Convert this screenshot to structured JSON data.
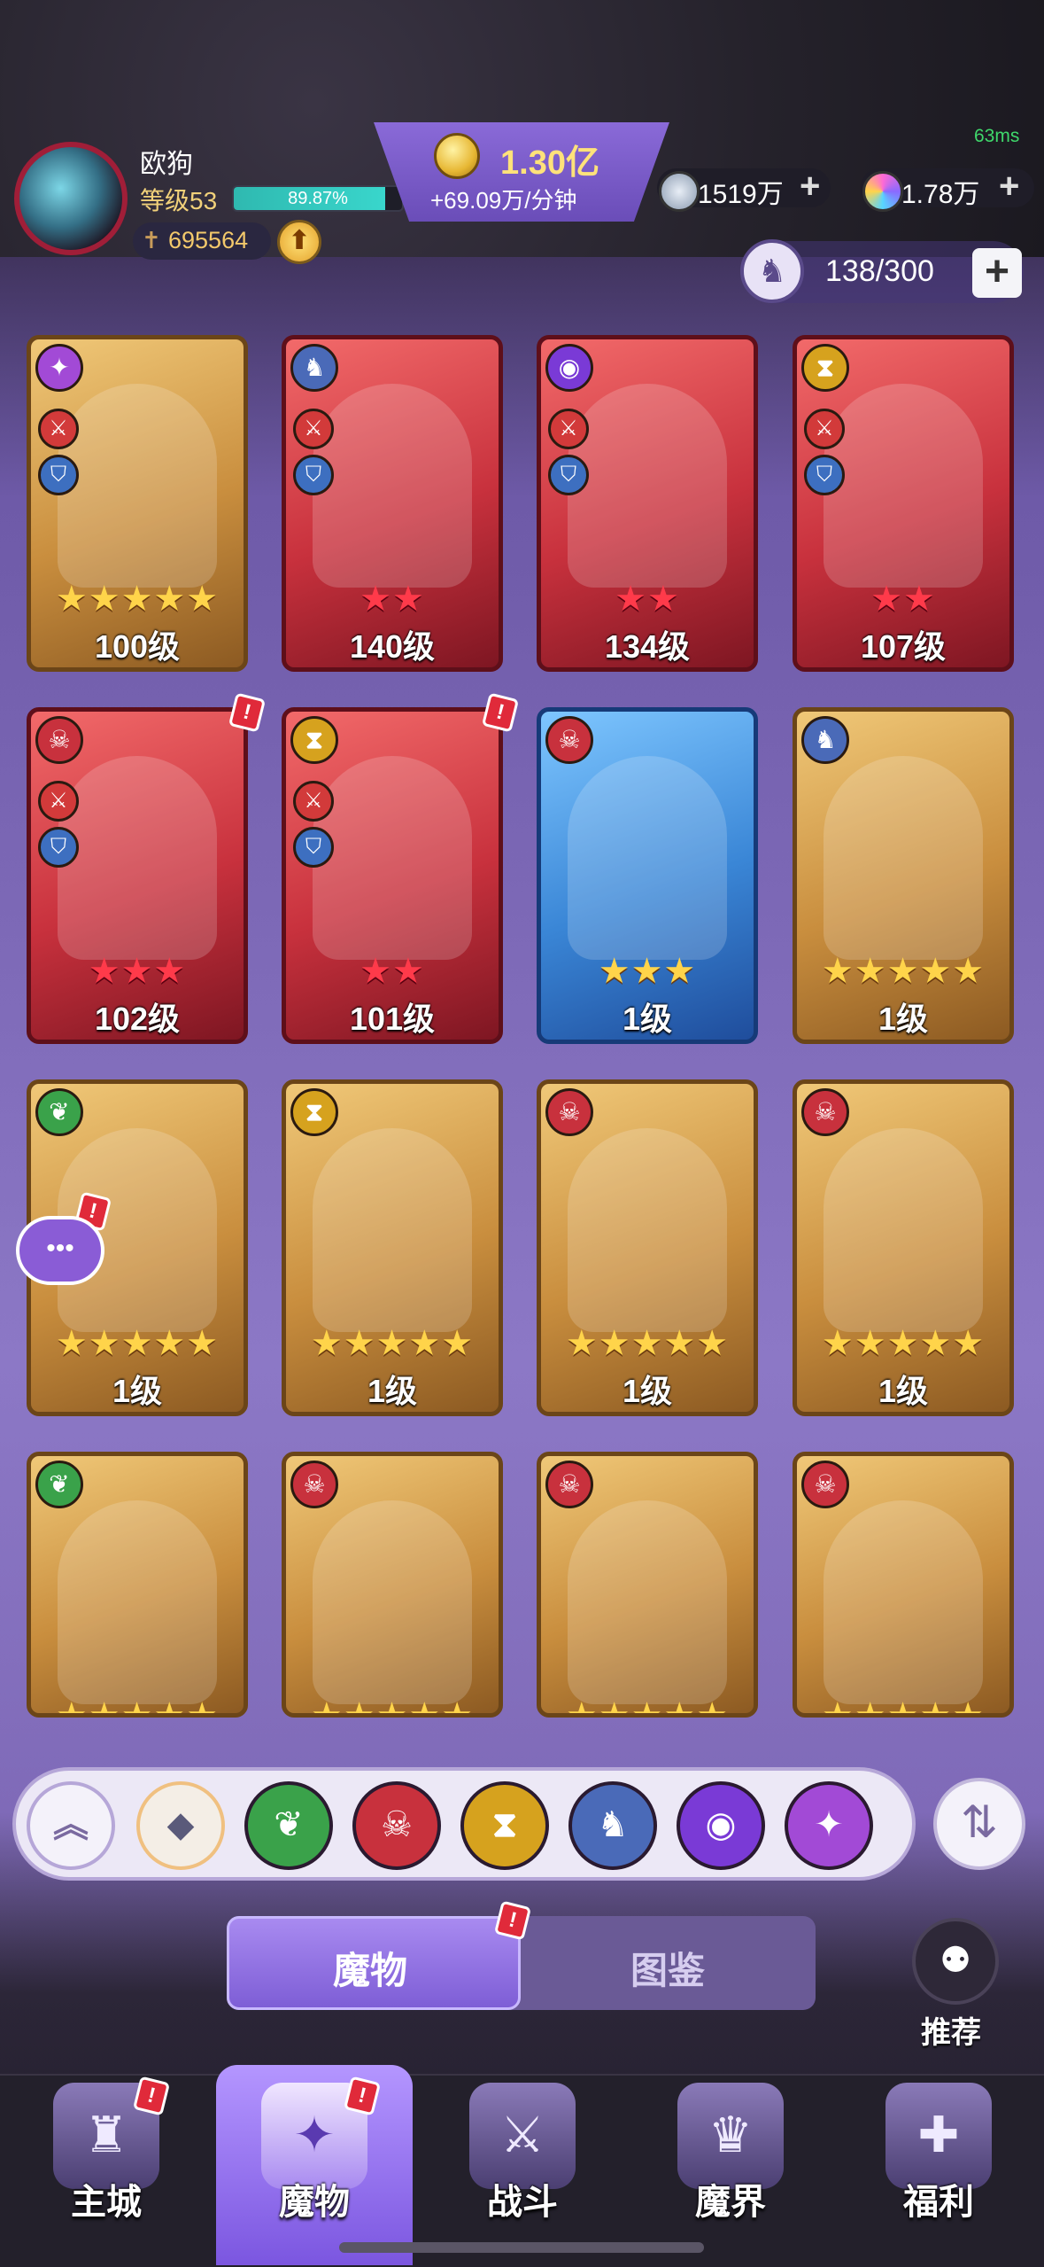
{
  "player": {
    "name": "欧狗",
    "level_label": "等级53",
    "xp_percent": "89.87%",
    "xp_fraction": 0.8987,
    "power_value": "695564"
  },
  "resources": {
    "gold_value": "1.30亿",
    "gold_rate": "+69.09万/分钟",
    "currency1_value": "1519万",
    "currency2_value": "1.78万",
    "plus": "+"
  },
  "ping": "63ms",
  "capacity": {
    "text": "138/300",
    "plus": "+"
  },
  "cards": [
    {
      "level": "100级",
      "stars": "★★★★★",
      "star_color": "gold",
      "frame": "gold"
    },
    {
      "level": "140级",
      "stars": "★★",
      "star_color": "red",
      "frame": "red"
    },
    {
      "level": "134级",
      "stars": "★★",
      "star_color": "red",
      "frame": "red"
    },
    {
      "level": "107级",
      "stars": "★★",
      "star_color": "red",
      "frame": "red"
    },
    {
      "level": "102级",
      "stars": "★★★",
      "star_color": "red",
      "frame": "red"
    },
    {
      "level": "101级",
      "stars": "★★",
      "star_color": "red",
      "frame": "red"
    },
    {
      "level": "1级",
      "stars": "★★★",
      "star_color": "gold",
      "frame": "blue"
    },
    {
      "level": "1级",
      "stars": "★★★★★",
      "star_color": "gold",
      "frame": "gold"
    },
    {
      "level": "1级",
      "stars": "★★★★★",
      "star_color": "gold",
      "frame": "gold"
    },
    {
      "level": "1级",
      "stars": "★★★★★",
      "star_color": "gold",
      "frame": "gold"
    },
    {
      "level": "1级",
      "stars": "★★★★★",
      "star_color": "gold",
      "frame": "gold"
    },
    {
      "level": "1级",
      "stars": "★★★★★",
      "star_color": "gold",
      "frame": "gold"
    },
    {
      "stars": "★★★★★",
      "frame": "gold"
    },
    {
      "stars": "★★★★★",
      "frame": "gold"
    },
    {
      "stars": "★★★★★",
      "frame": "gold"
    },
    {
      "stars": "★★★★★",
      "frame": "gold"
    }
  ],
  "filters": {
    "up": "︽",
    "all": "◆",
    "nature": "❦",
    "demon": "☠",
    "time": "⧗",
    "dragon": "♞",
    "eye": "◉",
    "chaos": "✦",
    "sort": "⇅"
  },
  "tabs": {
    "monsters": "魔物",
    "codex": "图鉴"
  },
  "recommend": {
    "label": "推荐",
    "icon": "⚉"
  },
  "nav": [
    {
      "label": "主城",
      "icon": "♜"
    },
    {
      "label": "魔物",
      "icon": "✦"
    },
    {
      "label": "战斗",
      "icon": "⚔"
    },
    {
      "label": "魔界",
      "icon": "♛"
    },
    {
      "label": "福利",
      "icon": "✚"
    }
  ],
  "colors": {
    "accent": "#8a6ad8",
    "gold": "#ffd44a",
    "red_star": "#ff3a4a",
    "alert": "#e02a3a"
  }
}
